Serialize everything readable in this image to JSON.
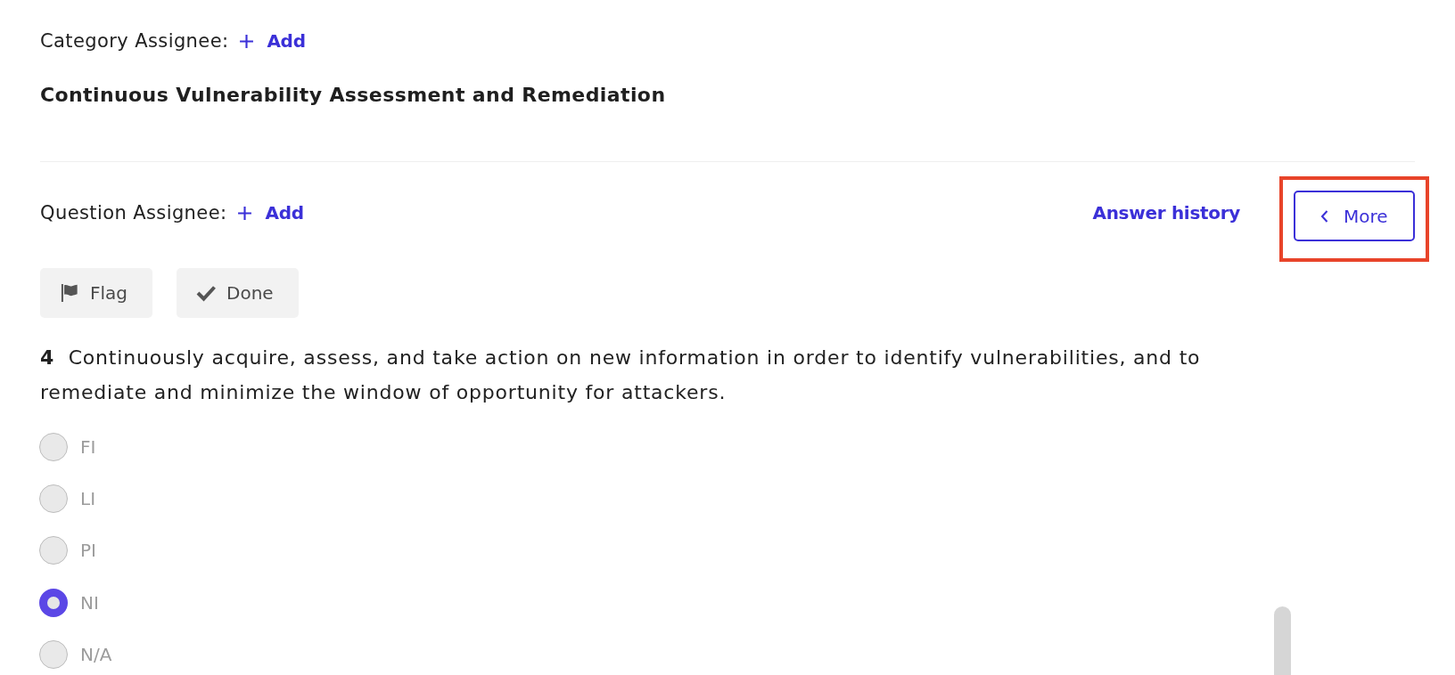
{
  "category": {
    "assignee_label": "Category Assignee:",
    "add_button": "Add",
    "title": "Continuous Vulnerability Assessment and Remediation"
  },
  "question_header": {
    "assignee_label": "Question Assignee:",
    "add_button": "Add",
    "answer_history_link": "Answer history",
    "more_button": {
      "label": "More",
      "highlighted": true
    }
  },
  "actions": [
    {
      "kind": "flag",
      "label": "Flag"
    },
    {
      "kind": "done",
      "label": "Done"
    }
  ],
  "question": {
    "number": "4",
    "text": "Continuously acquire, assess, and take action on new information in order to identify vulnerabilities, and to remediate and minimize the window of opportunity for attackers."
  },
  "options": [
    {
      "label": "FI",
      "selected": false
    },
    {
      "label": "LI",
      "selected": false
    },
    {
      "label": "PI",
      "selected": false
    },
    {
      "label": "NI",
      "selected": true
    },
    {
      "label": "N/A",
      "selected": false
    }
  ]
}
